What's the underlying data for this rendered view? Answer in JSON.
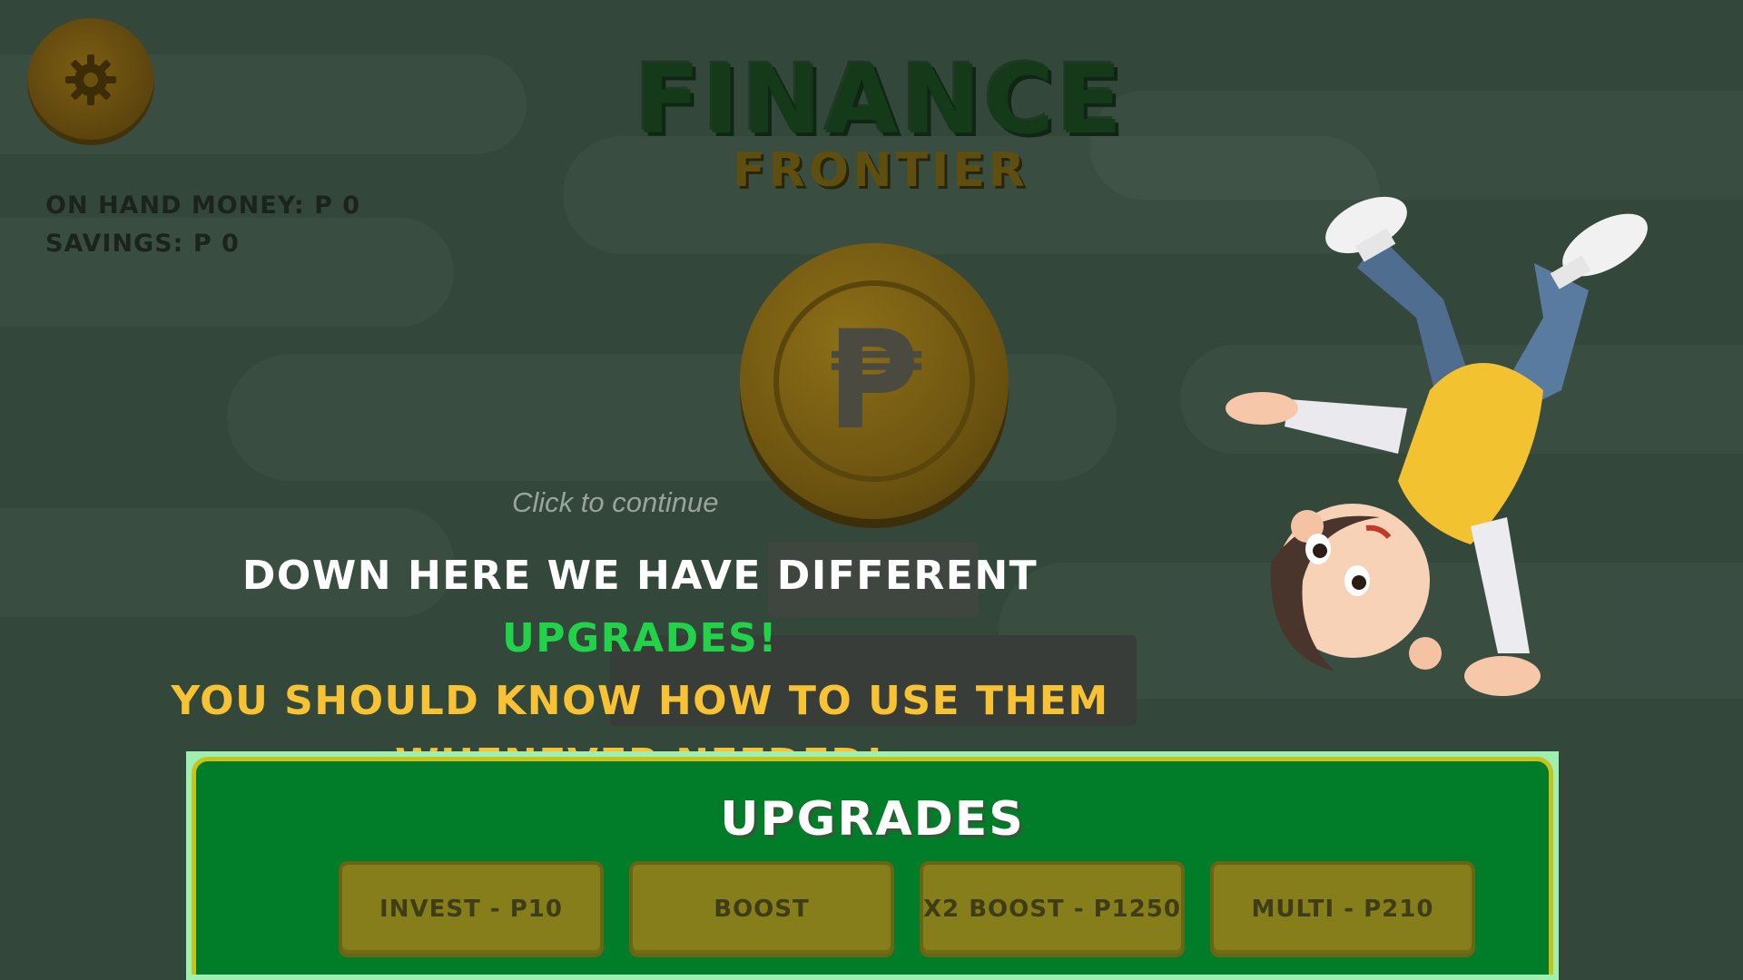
{
  "settings": {
    "icon": "gear-icon"
  },
  "stats": {
    "on_hand": "ON HAND MONEY: P 0",
    "savings": "SAVINGS: P 0"
  },
  "logo": {
    "title": "FINANCE",
    "subtitle": "FRONTIER"
  },
  "coin": {
    "symbol": "₱"
  },
  "hint": "Click to continue",
  "dialogue": {
    "line1_white": "DOWN HERE WE HAVE DIFFERENT ",
    "line1_green": "UPGRADES!",
    "line2": "YOU SHOULD KNOW HOW TO USE THEM",
    "line3": "WHENEVER NEEDED!"
  },
  "upgrades": {
    "title": "UPGRADES",
    "buttons": [
      "INVEST - P10",
      "BOOST",
      "X2 BOOST - P1250",
      "MULTI - P210"
    ]
  },
  "colors": {
    "highlight_green": "#22d34a",
    "dialogue_yellow": "#f7c334",
    "panel_green": "#017c28",
    "button_olive": "#857e1b"
  }
}
